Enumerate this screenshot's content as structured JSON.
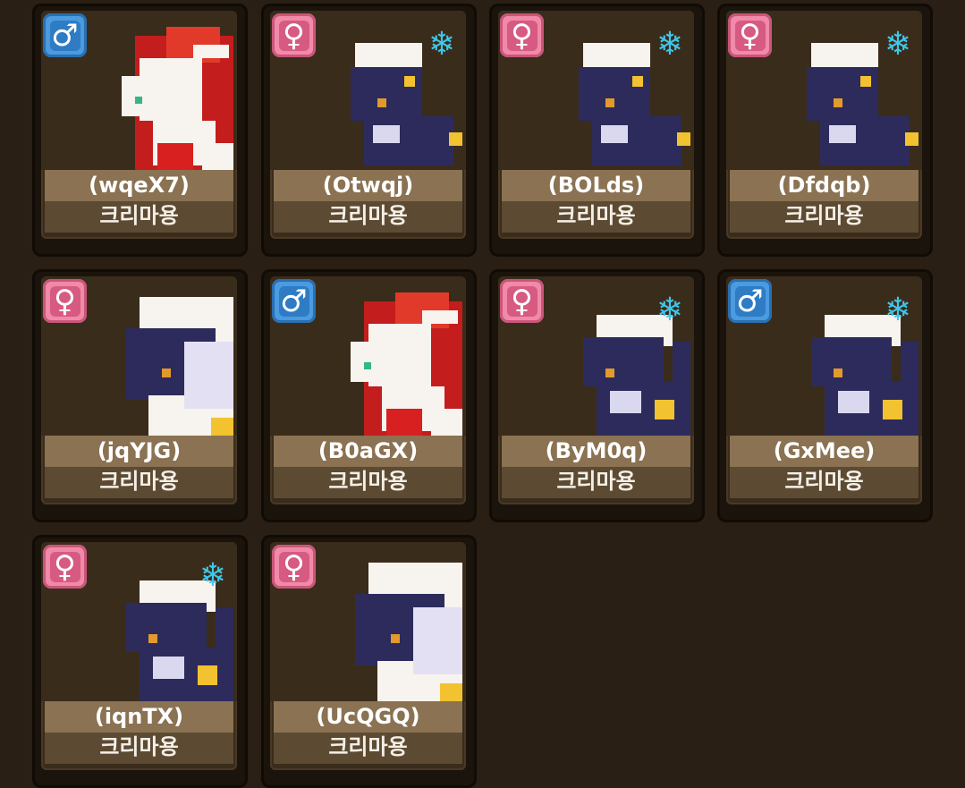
{
  "pets": [
    {
      "code": "(wqeX7)",
      "species": "크리마용",
      "gender": "male",
      "gender_symbol": "♂",
      "variant": "red",
      "snow": false
    },
    {
      "code": "(Otwqj)",
      "species": "크리마용",
      "gender": "female",
      "gender_symbol": "♀",
      "variant": "navy-sit",
      "snow": true
    },
    {
      "code": "(BOLds)",
      "species": "크리마용",
      "gender": "female",
      "gender_symbol": "♀",
      "variant": "navy-sit",
      "snow": true
    },
    {
      "code": "(Dfdqb)",
      "species": "크리마용",
      "gender": "female",
      "gender_symbol": "♀",
      "variant": "navy-sit",
      "snow": true
    },
    {
      "code": "(jqYJG)",
      "species": "크리마용",
      "gender": "female",
      "gender_symbol": "♀",
      "variant": "navy-big",
      "snow": false
    },
    {
      "code": "(B0aGX)",
      "species": "크리마용",
      "gender": "male",
      "gender_symbol": "♂",
      "variant": "red",
      "snow": false
    },
    {
      "code": "(ByM0q)",
      "species": "크리마용",
      "gender": "female",
      "gender_symbol": "♀",
      "variant": "navy-wing",
      "snow": true
    },
    {
      "code": "(GxMee)",
      "species": "크리마용",
      "gender": "male",
      "gender_symbol": "♂",
      "variant": "navy-wing",
      "snow": true
    },
    {
      "code": "(iqnTX)",
      "species": "크리마용",
      "gender": "female",
      "gender_symbol": "♀",
      "variant": "navy-wing",
      "snow": true
    },
    {
      "code": "(UcQGQ)",
      "species": "크리마용",
      "gender": "female",
      "gender_symbol": "♀",
      "variant": "navy-big",
      "snow": false
    }
  ],
  "icons": {
    "snow": "❄"
  },
  "colors": {
    "male_badge": "#4a9be0",
    "female_badge": "#f08aa8",
    "snow": "#3fc7ea",
    "name_plate": "#8a7252",
    "species_plate": "#5c4a33"
  }
}
